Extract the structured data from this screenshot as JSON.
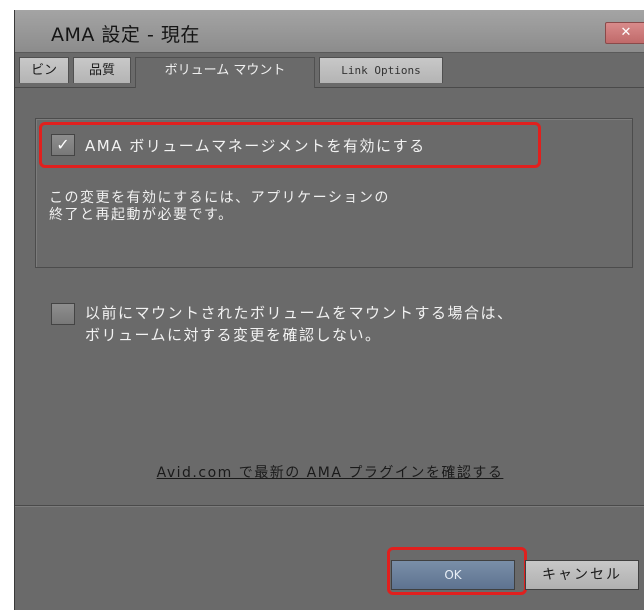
{
  "window": {
    "title": "AMA 設定 - 現在",
    "close_label": "✕"
  },
  "tabs": [
    {
      "label": "ビン",
      "active": false
    },
    {
      "label": "品質",
      "active": false
    },
    {
      "label": "ボリューム マウント",
      "active": true
    },
    {
      "label": "Link Options",
      "active": false
    }
  ],
  "volume_management": {
    "label": "AMA ボリュームマネージメントを有効にする",
    "checked": true,
    "check_glyph": "✓",
    "note_line1": "この変更を有効にするには、アプリケーションの",
    "note_line2": "終了と再起動が必要です。"
  },
  "skip_confirm": {
    "label_line1": "以前にマウントされたボリュームをマウントする場合は、",
    "label_line2": "ボリュームに対する変更を確認しない。",
    "checked": false
  },
  "plugin_link": "Avid.com で最新の AMA プラグインを確認する",
  "buttons": {
    "ok": "OK",
    "cancel": "キャンセル"
  },
  "colors": {
    "highlight": "#e0201e",
    "dialog_bg": "#6a6a6a"
  }
}
